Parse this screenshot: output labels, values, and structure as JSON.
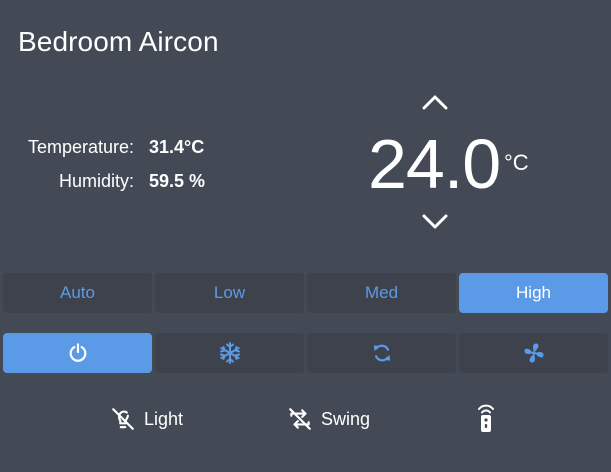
{
  "card": {
    "title": "Bedroom Aircon"
  },
  "readings": {
    "temperature_label": "Temperature:",
    "temperature_value": "31.4°C",
    "humidity_label": "Humidity:",
    "humidity_value": "59.5 %"
  },
  "setpoint": {
    "value": "24.0",
    "unit": "°C",
    "up_icon": "chevron-up-icon",
    "down_icon": "chevron-down-icon"
  },
  "fan_speeds": [
    {
      "label": "Auto",
      "active": false
    },
    {
      "label": "Low",
      "active": false
    },
    {
      "label": "Med",
      "active": false
    },
    {
      "label": "High",
      "active": true
    }
  ],
  "modes": [
    {
      "icon": "power-icon",
      "active": true
    },
    {
      "icon": "snowflake-icon",
      "active": false
    },
    {
      "icon": "refresh-cycle-icon",
      "active": false
    },
    {
      "icon": "fan-icon",
      "active": false
    }
  ],
  "extras": {
    "light_label": "Light",
    "light_icon": "light-off-icon",
    "swing_label": "Swing",
    "swing_icon": "swing-off-icon",
    "remote_icon": "remote-icon"
  },
  "colors": {
    "background": "#434955",
    "button": "#3d424c",
    "accent": "#5a9ae6",
    "text": "#ffffff"
  }
}
